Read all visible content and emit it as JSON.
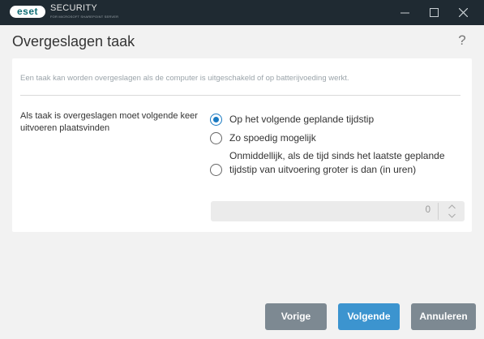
{
  "window": {
    "logo_text": "eset",
    "brand_main": "SECURITY",
    "brand_sub": "FOR MICROSOFT SHAREPOINT SERVER"
  },
  "header": {
    "title": "Overgeslagen taak",
    "help": "?"
  },
  "content": {
    "hint": "Een taak kan worden overgeslagen als de computer is uitgeschakeld of op batterijvoeding werkt.",
    "setting_label": "Als taak is overgeslagen moet volgende keer uitvoeren plaatsvinden",
    "options": [
      {
        "label": "Op het volgende geplande tijdstip",
        "selected": true
      },
      {
        "label": "Zo spoedig mogelijk",
        "selected": false
      },
      {
        "label": "Onmiddellijk, als de tijd sinds het laatste geplande tijdstip van uitvoering groter is dan (in uren)",
        "selected": false
      }
    ],
    "hours_value": "0"
  },
  "footer": {
    "prev_label": "Vorige",
    "next_label": "Volgende",
    "cancel_label": "Annuleren"
  },
  "colors": {
    "titlebar": "#1f2a32",
    "accent": "#3c94cf",
    "radio_selected": "#1a7ac2",
    "button_gray": "#7d8992"
  }
}
